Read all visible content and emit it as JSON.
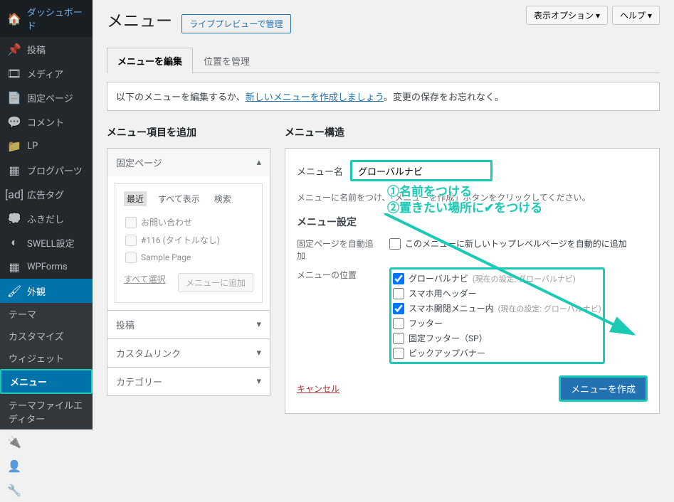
{
  "sidebar": {
    "items": [
      {
        "icon": "🏠",
        "label": "ダッシュボード"
      },
      {
        "icon": "📌",
        "label": "投稿"
      },
      {
        "icon": "🎞",
        "label": "メディア"
      },
      {
        "icon": "📄",
        "label": "固定ページ"
      },
      {
        "icon": "💬",
        "label": "コメント"
      },
      {
        "icon": "📁",
        "label": "LP"
      },
      {
        "icon": "▦",
        "label": "ブログパーツ"
      },
      {
        "icon": "[ad]",
        "label": "広告タグ"
      },
      {
        "icon": "💭",
        "label": "ふきだし"
      },
      {
        "icon": "◐",
        "label": "SWELL設定"
      },
      {
        "icon": "▦",
        "label": "WPForms"
      },
      {
        "icon": "🖌",
        "label": "外観"
      }
    ],
    "subs": [
      "テーマ",
      "カスタマイズ",
      "ウィジェット",
      "メニュー",
      "テーマファイルエディター"
    ],
    "after": [
      {
        "icon": "🔌",
        "label": "プラグイン"
      },
      {
        "icon": "👤",
        "label": "ユーザー"
      },
      {
        "icon": "🔧",
        "label": "ツール"
      }
    ]
  },
  "top": {
    "screen_options": "表示オプション ▾",
    "help": "ヘルプ ▾"
  },
  "page": {
    "title": "メニュー",
    "live_preview": "ライブプレビューで管理"
  },
  "tabs": {
    "edit": "メニューを編集",
    "locations": "位置を管理"
  },
  "intro": {
    "before": "以下のメニューを編集するか、",
    "link": "新しいメニューを作成しましょう",
    "after": "。変更の保存をお忘れなく。"
  },
  "left": {
    "title": "メニュー項目を追加",
    "acc_pages": "固定ページ",
    "inner_tabs": {
      "recent": "最近",
      "all": "すべて表示",
      "search": "検索"
    },
    "items": [
      "お問い合わせ",
      "#116 (タイトルなし)",
      "Sample Page"
    ],
    "select_all": "すべて選択",
    "add_btn": "メニューに追加",
    "acc_posts": "投稿",
    "acc_custom": "カスタムリンク",
    "acc_cat": "カテゴリー"
  },
  "right": {
    "title": "メニュー構造",
    "name_label": "メニュー名",
    "name_value": "グローバルナビ",
    "hint": "メニューに名前をつけ、「メニューを作成」ボタンをクリックしてください。",
    "settings_title": "メニュー設定",
    "auto_add_label": "固定ページを自動追加",
    "auto_add_desc": "このメニューに新しいトップレベルページを自動的に追加",
    "loc_label": "メニューの位置",
    "locations": [
      {
        "label": "グローバルナビ",
        "note": "(現在の設定: グローバルナビ)",
        "checked": true
      },
      {
        "label": "スマホ用ヘッダー",
        "checked": false
      },
      {
        "label": "スマホ開閉メニュー内",
        "note": "(現在の設定: グローバルナビ)",
        "checked": true
      },
      {
        "label": "フッター",
        "checked": false
      },
      {
        "label": "固定フッター（SP）",
        "checked": false
      },
      {
        "label": "ピックアップバナー",
        "checked": false
      }
    ],
    "cancel": "キャンセル",
    "create": "メニューを作成"
  },
  "annotations": {
    "line1": "①名前をつける",
    "line2": "②置きたい場所に✔をつける"
  }
}
